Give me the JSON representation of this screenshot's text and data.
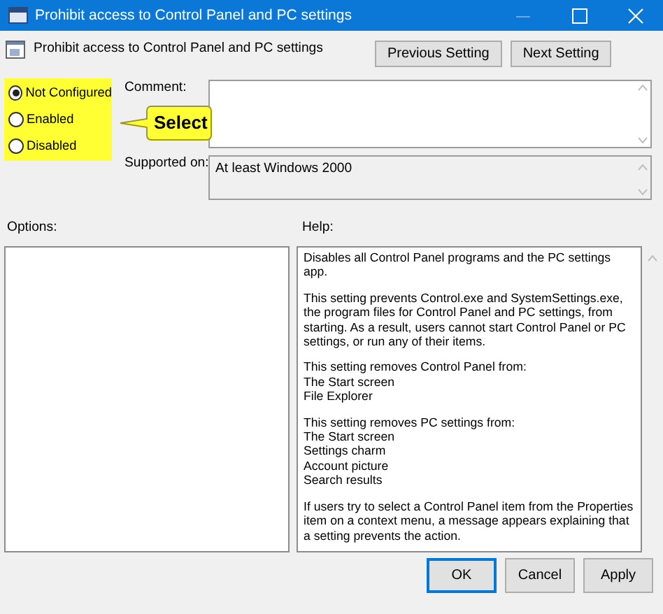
{
  "window": {
    "title": "Prohibit access to Control Panel and PC settings"
  },
  "setting": {
    "title": "Prohibit access to Control Panel and PC settings"
  },
  "nav_buttons": [
    "Previous Setting",
    "Next Setting"
  ],
  "state_options": [
    {
      "label": "Not Configured",
      "selected": true
    },
    {
      "label": "Enabled",
      "selected": false
    },
    {
      "label": "Disabled",
      "selected": false
    }
  ],
  "callout": {
    "text": "Select"
  },
  "comment": {
    "label": "Comment:"
  },
  "supported_on": {
    "label": "Supported on:",
    "value": "At least Windows 2000"
  },
  "options": {
    "label": "Options:"
  },
  "help": {
    "label": "Help:",
    "paragraphs": [
      {
        "lines": [
          "Disables all Control Panel programs and the PC settings app."
        ]
      },
      {
        "lines": [
          "This setting prevents Control.exe and SystemSettings.exe, the program files for Control Panel and PC settings, from starting. As a result, users cannot start Control Panel or PC settings, or run any of their items."
        ]
      },
      {
        "lines": [
          "This setting removes Control Panel from:",
          "The Start screen",
          "File Explorer"
        ]
      },
      {
        "lines": [
          "This setting removes PC settings from:",
          "The Start screen",
          "Settings charm",
          "Account picture",
          "Search results"
        ]
      },
      {
        "lines": [
          "If users try to select a Control Panel item from the Properties item on a context menu, a message appears explaining that a setting prevents the action."
        ]
      }
    ]
  },
  "footer_buttons": [
    "OK",
    "Cancel",
    "Apply"
  ]
}
